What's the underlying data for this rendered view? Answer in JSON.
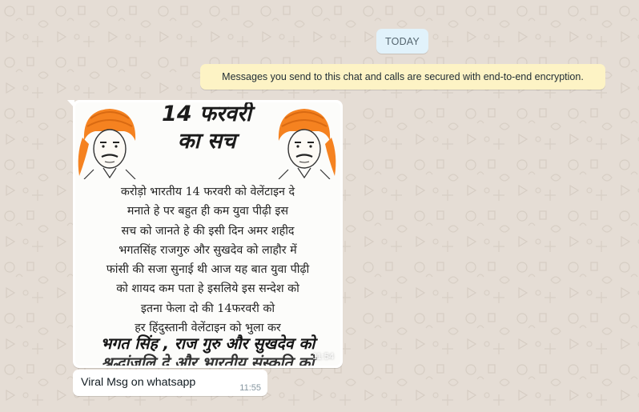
{
  "chat": {
    "date_chip": "TODAY",
    "encryption_notice": "Messages you send to this chat and calls are secured with end-to-end encryption."
  },
  "messages": [
    {
      "type": "image",
      "time": "11:54",
      "poster": {
        "title_line1": "14 फरवरी",
        "title_line2": "का सच",
        "body_lines": [
          "करोड़ो भारतीय 14 फरवरी को वेलेंटाइन दे",
          "मनाते हे पर बहुत ही कम युवा पीढ़ी इस",
          "सच को जानते हे की इसी दिन अमर शहीद",
          "भगतसिंह राजगुरु और सुखदेव को लाहौर में",
          "फांसी की सजा सुनाई थी आज यह बात युवा पीढ़ी",
          "को शायद कम पता हे इसलिये इस सन्देश को",
          "इतना फेला दो की 14फरवरी को",
          "हर हिंदुस्तानी वेलेंटाइन को भुला कर"
        ],
        "footer_line": "भगत सिंह , राज गुरु और सुखदेव को",
        "cut_line": "श्रद्धांजलि दे और भारतीय संस्कृति को"
      }
    },
    {
      "type": "text",
      "text": "Viral Msg on whatsapp",
      "time": "11:55"
    }
  ],
  "colors": {
    "wallpaper": "#e5ddd5",
    "date_chip": "#e1f2fb",
    "encryption_note": "#fdf3c5",
    "incoming_bubble": "#ffffff",
    "turban": "#f58220"
  },
  "icons": [
    "wallpaper-doodle-pattern",
    "portrait-illustration"
  ]
}
